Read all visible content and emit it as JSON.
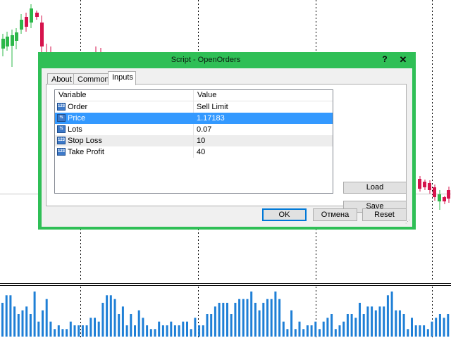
{
  "window": {
    "title": "Script - OpenOrders",
    "help_glyph": "?",
    "close_glyph": "✕"
  },
  "tabs": [
    {
      "label": "About",
      "active": false
    },
    {
      "label": "Common",
      "active": false
    },
    {
      "label": "Inputs",
      "active": true
    }
  ],
  "inputs": {
    "columns": {
      "variable": "Variable",
      "value": "Value"
    },
    "rows": [
      {
        "name": "Order",
        "value": "Sell Limit",
        "icon": "enum-icon",
        "selected": false
      },
      {
        "name": "Price",
        "value": "1.17183",
        "icon": "double-icon",
        "selected": true
      },
      {
        "name": "Lots",
        "value": "0.07",
        "icon": "double-icon",
        "selected": false
      },
      {
        "name": "Stop Loss",
        "value": "10",
        "icon": "integer-icon",
        "selected": false
      },
      {
        "name": "Take Profit",
        "value": "40",
        "icon": "integer-icon",
        "selected": false
      }
    ]
  },
  "buttons": {
    "load": "Load",
    "save": "Save",
    "ok": "OK",
    "cancel": "Отмена",
    "reset": "Reset"
  },
  "colors": {
    "dialog_frame": "#2fbf56",
    "selection": "#3399ff",
    "bull_candle": "#2db84a",
    "bear_candle": "#d6134c",
    "volume_bar": "#1f7fd6"
  },
  "chart_data": {
    "type": "bar",
    "volumes": [
      9,
      11,
      11,
      8,
      6,
      7,
      8,
      6,
      12,
      4,
      7,
      10,
      4,
      2,
      3,
      2,
      2,
      4,
      3,
      3,
      3,
      3,
      5,
      5,
      4,
      9,
      11,
      11,
      10,
      6,
      8,
      3,
      6,
      3,
      7,
      5,
      3,
      2,
      2,
      4,
      3,
      3,
      4,
      3,
      3,
      4,
      4,
      2,
      5,
      3,
      3,
      6,
      6,
      8,
      9,
      9,
      9,
      6,
      9,
      10,
      10,
      10,
      12,
      9,
      7,
      9,
      10,
      10,
      12,
      10,
      4,
      2,
      7,
      2,
      4,
      2,
      3,
      3,
      4,
      2,
      4,
      5,
      6,
      2,
      3,
      4,
      6,
      6,
      5,
      9,
      6,
      8,
      8,
      7,
      8,
      8,
      11,
      12,
      7,
      7,
      6,
      2,
      5,
      3,
      3,
      3,
      2,
      4,
      5,
      6,
      5,
      6
    ]
  }
}
